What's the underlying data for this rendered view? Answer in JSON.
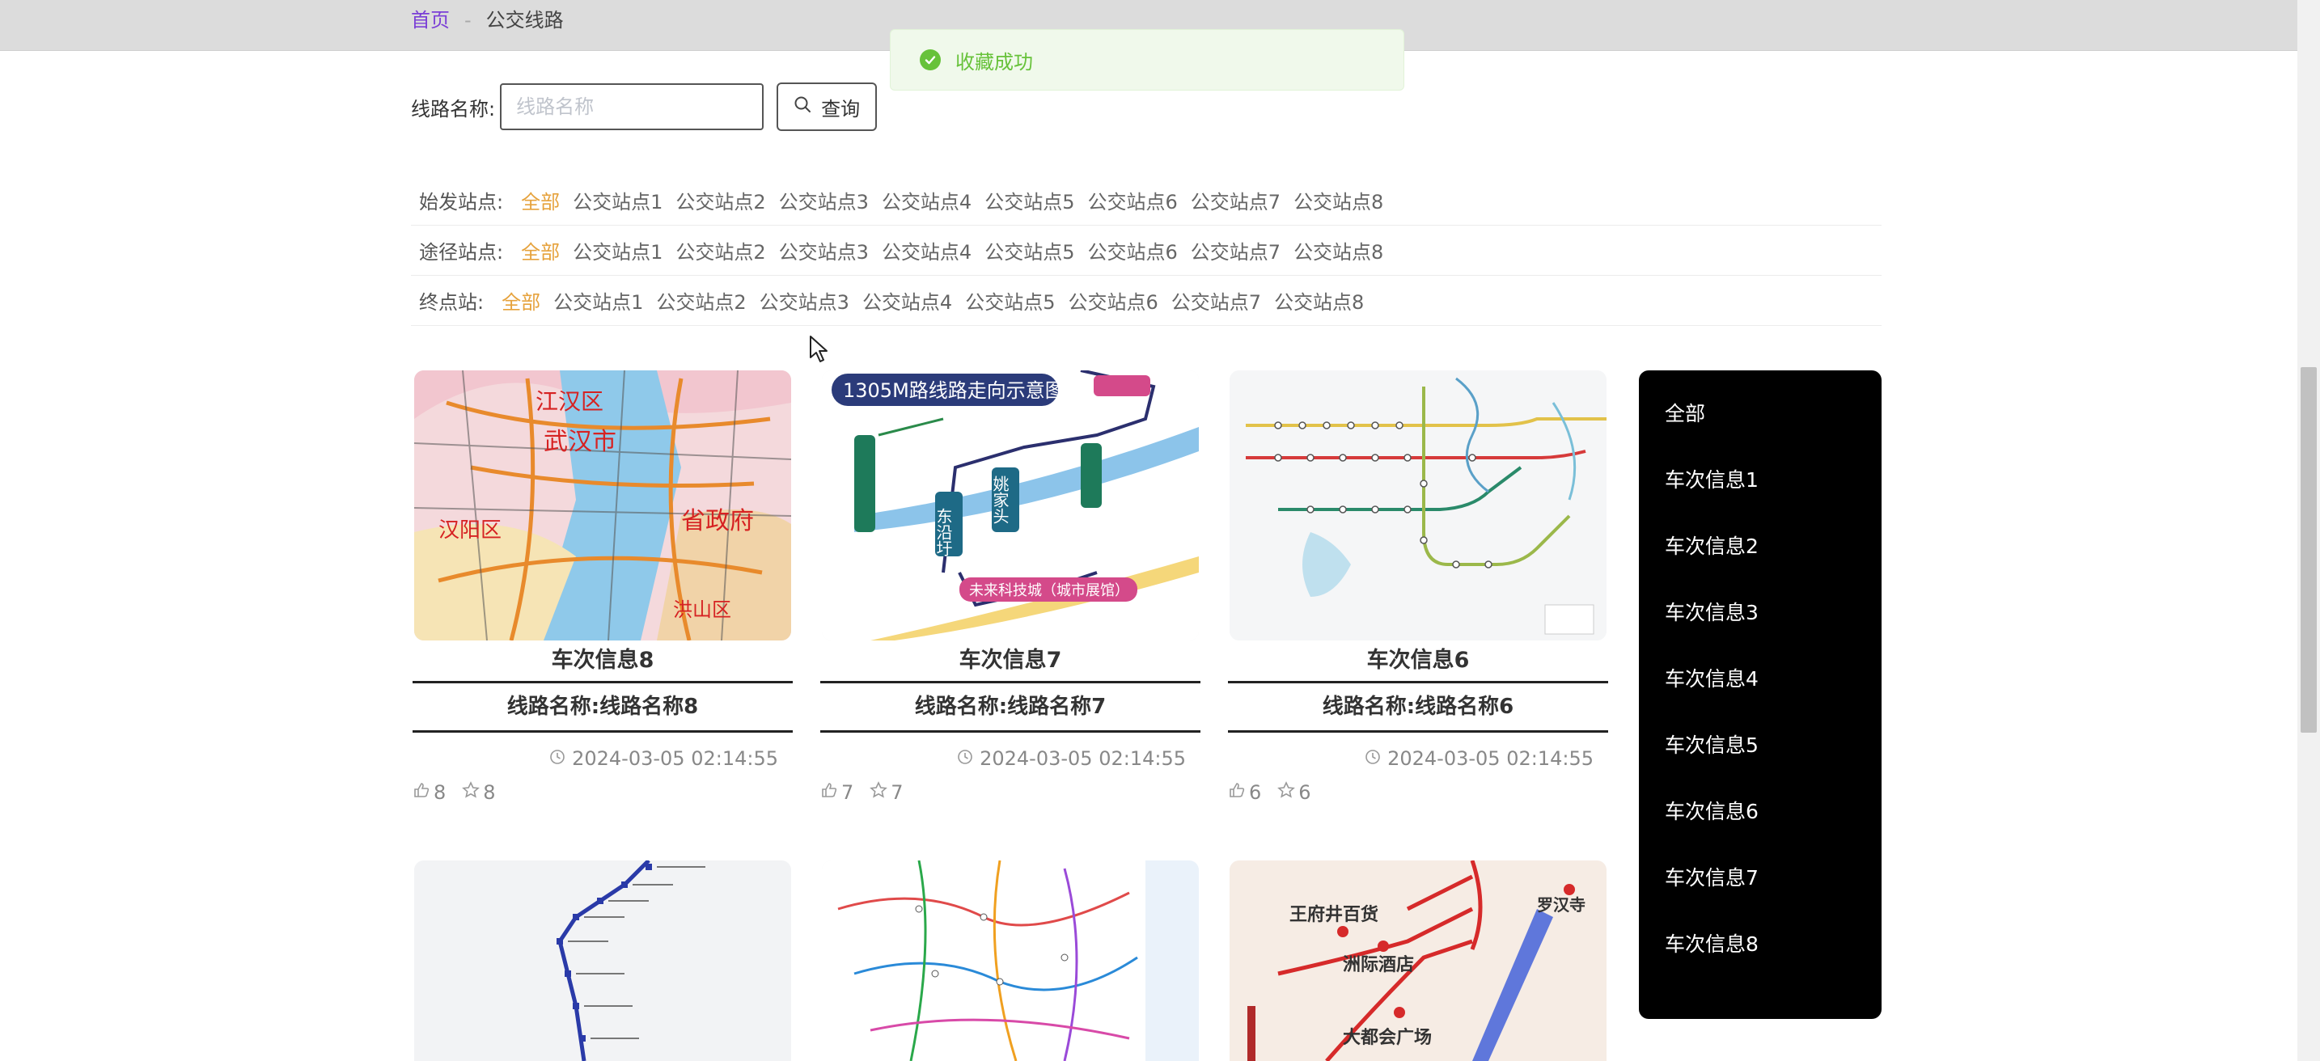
{
  "breadcrumb": {
    "home": "首页",
    "separator": "-",
    "current": "公交线路"
  },
  "toast": {
    "message": "收藏成功"
  },
  "search": {
    "label": "线路名称:",
    "placeholder": "线路名称",
    "value": "",
    "button": "查询"
  },
  "filters": [
    {
      "label": "始发站点:",
      "options": [
        "全部",
        "公交站点1",
        "公交站点2",
        "公交站点3",
        "公交站点4",
        "公交站点5",
        "公交站点6",
        "公交站点7",
        "公交站点8"
      ],
      "active": 0
    },
    {
      "label": "途径站点:",
      "options": [
        "全部",
        "公交站点1",
        "公交站点2",
        "公交站点3",
        "公交站点4",
        "公交站点5",
        "公交站点6",
        "公交站点7",
        "公交站点8"
      ],
      "active": 0
    },
    {
      "label": "终点站:",
      "options": [
        "全部",
        "公交站点1",
        "公交站点2",
        "公交站点3",
        "公交站点4",
        "公交站点5",
        "公交站点6",
        "公交站点7",
        "公交站点8"
      ],
      "active": 0
    }
  ],
  "cards": [
    {
      "title": "车次信息8",
      "line": "线路名称:线路名称8",
      "date": "2024-03-05 02:14:55",
      "likes": "8",
      "favorites": "8",
      "map_labels": [
        "江汉区",
        "武汉市",
        "省政府",
        "汉阳区",
        "洪山区"
      ]
    },
    {
      "title": "车次信息7",
      "line": "线路名称:线路名称7",
      "date": "2024-03-05 02:14:55",
      "likes": "7",
      "favorites": "7",
      "map_labels": [
        "1305M路线路走向示意图",
        "东沿圩",
        "姚家头",
        "未来科技城（城市展馆）"
      ]
    },
    {
      "title": "车次信息6",
      "line": "线路名称:线路名称6",
      "date": "2024-03-05 02:14:55",
      "likes": "6",
      "favorites": "6",
      "map_labels": []
    },
    {
      "map_labels": []
    },
    {
      "map_labels": []
    },
    {
      "map_labels": [
        "王府井百货",
        "洲际酒店",
        "大都会广场",
        "罗汉寺"
      ]
    }
  ],
  "side_menu": [
    "全部",
    "车次信息1",
    "车次信息2",
    "车次信息3",
    "车次信息4",
    "车次信息5",
    "车次信息6",
    "车次信息7",
    "车次信息8"
  ],
  "colors": {
    "active_filter": "#e6a23c",
    "home_link": "#7b3fd6",
    "toast_green": "#67c23a"
  }
}
